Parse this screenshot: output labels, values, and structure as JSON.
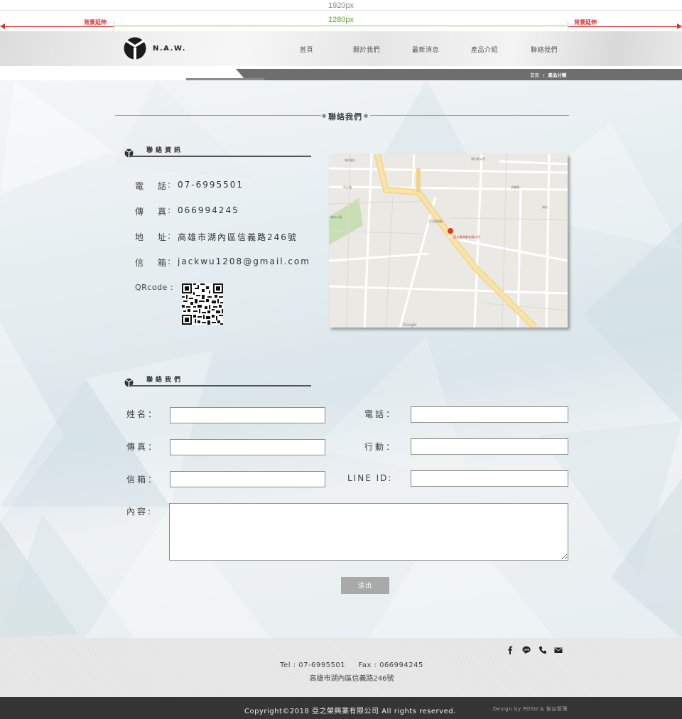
{
  "spec": {
    "total_width_label": "1920px",
    "content_width_label": "1280px",
    "bg_extend_left": "背景延伸",
    "bg_extend_right": "背景延伸"
  },
  "header": {
    "logo_text": "N.A.W.",
    "nav": [
      "首頁",
      "關於我們",
      "最新消息",
      "產品介紹",
      "聯絡我們"
    ]
  },
  "breadcrumb": {
    "home": "首頁",
    "separator": "/",
    "current": "產品分類"
  },
  "page_title": "聯絡我們",
  "contact_info": {
    "heading": "聯絡資訊",
    "items": [
      {
        "label": "電　話",
        "value": "07-6995501"
      },
      {
        "label": "傳　真",
        "value": "066994245"
      },
      {
        "label": "地　址",
        "value": "高雄市湖內區信義路246號"
      },
      {
        "label": "信　箱",
        "value": "jackwu1208@gmail.com"
      }
    ],
    "qr_label": "QRcode"
  },
  "map": {
    "pin_label": "亞之榮興業有限公司",
    "labels": [
      "湖內區公所",
      "湖內國小",
      "中正路",
      "信義路",
      "Google"
    ]
  },
  "form": {
    "heading": "聯絡我們",
    "fields": {
      "name": {
        "label": "姓名：",
        "value": ""
      },
      "phone": {
        "label": "電話：",
        "value": ""
      },
      "fax": {
        "label": "傳真：",
        "value": ""
      },
      "mobile": {
        "label": "行動：",
        "value": ""
      },
      "email": {
        "label": "信箱：",
        "value": ""
      },
      "line": {
        "label": "LINE ID:",
        "value": ""
      },
      "content": {
        "label": "內容:",
        "value": ""
      }
    },
    "submit_label": "送出"
  },
  "footer": {
    "contact_line": "Tel : 07-6995501     Fax : 066994245",
    "address": "高雄市湖內區信義路246號",
    "copyright": "Copyright©2018 亞之榮興業有限公司 All rights reserved.",
    "design_by": "Design by POSU & 後台管理",
    "social_icons": [
      "facebook-icon",
      "line-icon",
      "phone-icon",
      "mail-icon"
    ]
  }
}
